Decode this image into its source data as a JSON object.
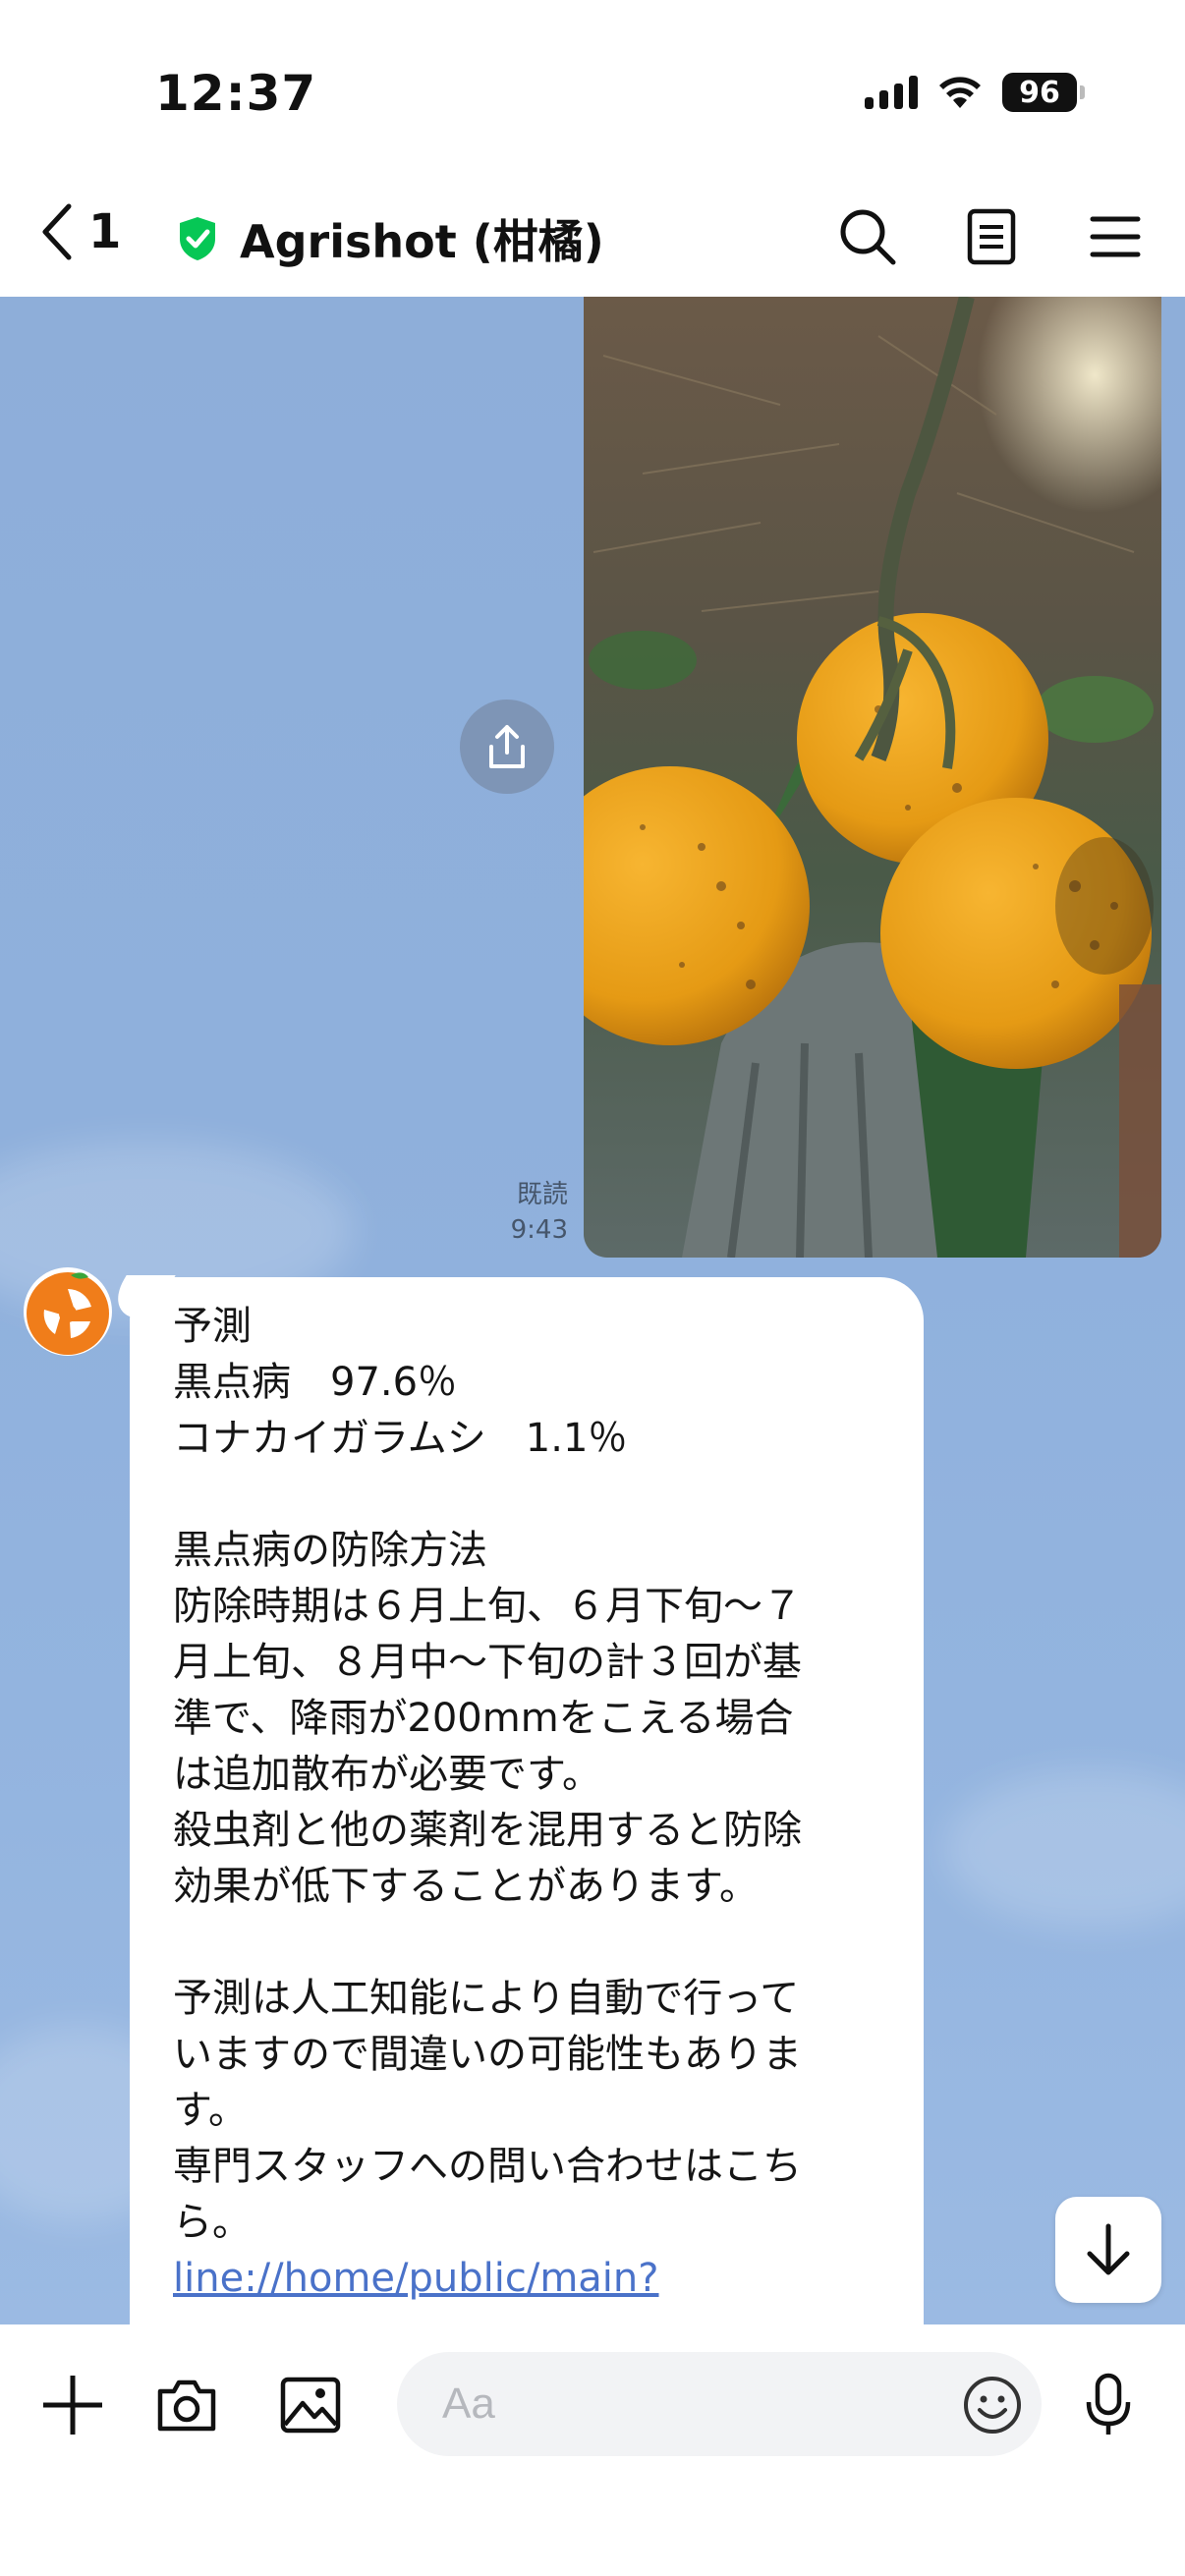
{
  "status_bar": {
    "time": "12:37",
    "battery": "96"
  },
  "header": {
    "back_count": "1",
    "title": "Agrishot (柑橘)",
    "icons": [
      "search-icon",
      "notes-icon",
      "menu-icon"
    ],
    "verified_color": "#06c755"
  },
  "chat": {
    "image_message": {
      "read_label": "既読",
      "time": "9:43"
    },
    "reply": {
      "lines": [
        "予測",
        "黒点病　97.6％",
        "コナカイガラムシ　1.1％",
        "",
        "黒点病の防除方法",
        "防除時期は６月上旬、６月下旬～７",
        "月上旬、８月中～下旬の計３回が基",
        "準で、降雨が200mmをこえる場合",
        "は追加散布が必要です。",
        "殺虫剤と他の薬剤を混用すると防除",
        "効果が低下することがあります。",
        "",
        "予測は人工知能により自動で行って",
        "いますので間違いの可能性もありま",
        "す。",
        "専門スタッフへの問い合わせはこち",
        "ら。"
      ],
      "link": "line://home/public/main?"
    }
  },
  "input_bar": {
    "placeholder": "Aa"
  },
  "colors": {
    "chat_background": "#8fb0dc",
    "link": "#4a72c9",
    "accent_orange": "#f07d1a"
  }
}
